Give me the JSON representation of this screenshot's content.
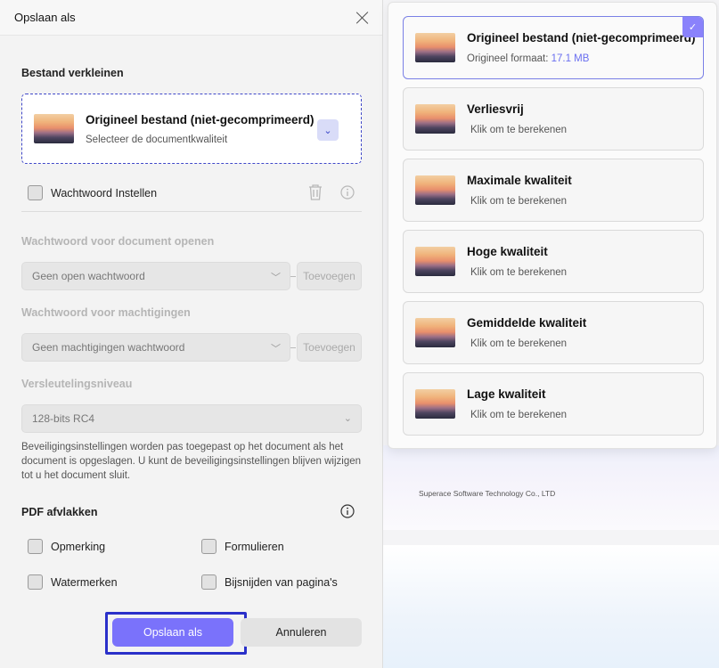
{
  "dialog": {
    "title": "Opslaan als",
    "reduce_section": "Bestand verkleinen",
    "quality_select": {
      "title": "Origineel bestand (niet-gecomprimeerd)",
      "subtitle": "Selecteer de documentkwaliteit"
    },
    "password_toggle_label": "Wachtwoord Instellen",
    "open_password": {
      "label": "Wachtwoord voor document openen",
      "value": "Geen open wachtwoord",
      "add_label": "Toevoegen"
    },
    "permissions_password": {
      "label": "Wachtwoord voor machtigingen",
      "value": "Geen machtigingen wachtwoord",
      "add_label": "Toevoegen"
    },
    "encryption": {
      "label": "Versleutelingsniveau",
      "value": "128-bits RC4"
    },
    "security_note": "Beveiligingsinstellingen worden pas toegepast op het document als het document is opgeslagen. U kunt de beveiligingsinstellingen blijven wijzigen tot u het document sluit.",
    "flatten_section": "PDF afvlakken",
    "flatten_options": {
      "comments": "Opmerking",
      "forms": "Formulieren",
      "watermarks": "Watermerken",
      "crop": "Bijsnijden van pagina's"
    },
    "save_label": "Opslaan als",
    "cancel_label": "Annuleren"
  },
  "quality_dropdown": {
    "options": [
      {
        "title": "Origineel bestand (niet-gecomprimeerd)",
        "sub_prefix": "Origineel formaat: ",
        "size": "17.1 MB",
        "selected": true
      },
      {
        "title": "Verliesvrij",
        "sub": "Klik om te berekenen"
      },
      {
        "title": "Maximale kwaliteit",
        "sub": "Klik om te berekenen"
      },
      {
        "title": "Hoge kwaliteit",
        "sub": "Klik om te berekenen"
      },
      {
        "title": "Gemiddelde kwaliteit",
        "sub": "Klik om te berekenen"
      },
      {
        "title": "Lage kwaliteit",
        "sub": "Klik om te berekenen"
      }
    ]
  },
  "background": {
    "company": "Superace Software Technology Co., LTD"
  },
  "colors": {
    "accent": "#7a72fb",
    "highlight": "#2a30c9"
  }
}
